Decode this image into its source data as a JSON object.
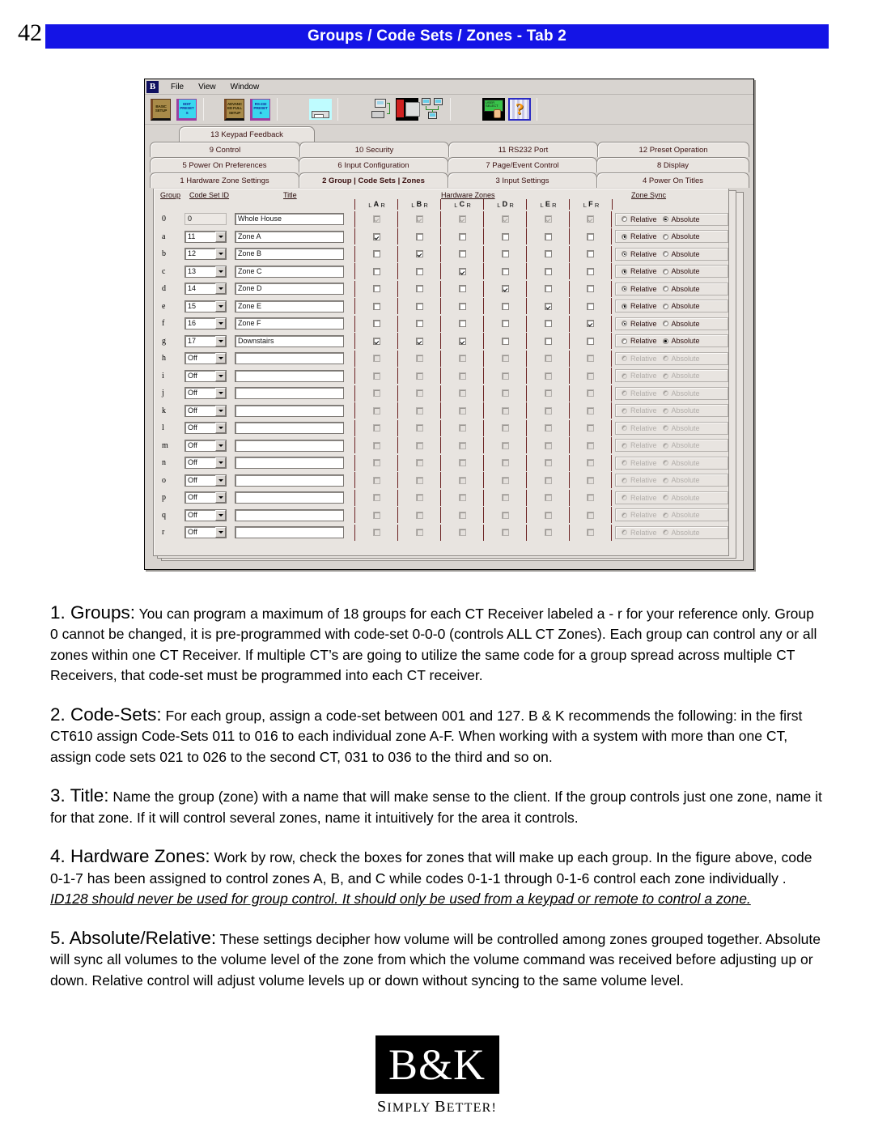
{
  "page": {
    "number": "42",
    "header_title": "Groups / Code Sets / Zones - Tab 2",
    "header_color": "#1414e6"
  },
  "app": {
    "menu": [
      "File",
      "View",
      "Window"
    ],
    "logo_icon": "bk-logo-icon",
    "toolbar_icons": [
      {
        "name": "basic-setup-icon",
        "label": "BASIC SETUP"
      },
      {
        "name": "edit-presets-icon",
        "label": "EDIT PRESETS"
      },
      {
        "name": "advanced-full-setup-icon",
        "label": "ADVANCED FULL SETUP"
      },
      {
        "name": "rs232-presets-icon",
        "label": "RS-232 PRESETS"
      },
      {
        "name": "device-front-panel-icon",
        "label": ""
      },
      {
        "name": "pc-to-device-icon",
        "label": ""
      },
      {
        "name": "rack-panel-icon",
        "label": ""
      },
      {
        "name": "network-icon",
        "label": ""
      },
      {
        "name": "user-select-icon",
        "label": ""
      },
      {
        "name": "help-icon",
        "label": "?"
      }
    ],
    "tab_rows": [
      [
        "13 Keypad Feedback"
      ],
      [
        "9   Control",
        "10   Security",
        "11   RS232 Port",
        "12   Preset Operation"
      ],
      [
        "5   Power On Preferences",
        "6   Input Configuration",
        "7   Page/Event Control",
        "8   Display"
      ],
      [
        "1   Hardware Zone Settings",
        "2  Group | Code Sets | Zones",
        "3   Input Settings",
        "4   Power On Titles"
      ]
    ],
    "active_tab": "2  Group | Code Sets | Zones",
    "column_headers": {
      "group": "Group",
      "code_set_id": "Code Set ID",
      "title": "Title",
      "hardware_zones": "Hardware Zones",
      "zone_sync": "Zone Sync"
    },
    "zone_letters": [
      "A",
      "B",
      "C",
      "D",
      "E",
      "F"
    ],
    "lr_labels": {
      "left": "L",
      "right": "R"
    },
    "sync_options": {
      "relative": "Relative",
      "absolute": "Absolute"
    },
    "dropdown_off_label": "Off",
    "rows": [
      {
        "group": "0",
        "code": "0",
        "title": "Whole House",
        "editable": false,
        "zones": [
          true,
          true,
          true,
          true,
          true,
          true
        ],
        "sync": "Absolute",
        "enabled": true
      },
      {
        "group": "a",
        "code": "11",
        "title": "Zone A",
        "editable": true,
        "zones": [
          true,
          false,
          false,
          false,
          false,
          false
        ],
        "sync": "Relative",
        "enabled": true
      },
      {
        "group": "b",
        "code": "12",
        "title": "Zone B",
        "editable": true,
        "zones": [
          false,
          true,
          false,
          false,
          false,
          false
        ],
        "sync": "Relative",
        "enabled": true
      },
      {
        "group": "c",
        "code": "13",
        "title": "Zone C",
        "editable": true,
        "zones": [
          false,
          false,
          true,
          false,
          false,
          false
        ],
        "sync": "Relative",
        "enabled": true
      },
      {
        "group": "d",
        "code": "14",
        "title": "Zone D",
        "editable": true,
        "zones": [
          false,
          false,
          false,
          true,
          false,
          false
        ],
        "sync": "Relative",
        "enabled": true
      },
      {
        "group": "e",
        "code": "15",
        "title": "Zone E",
        "editable": true,
        "zones": [
          false,
          false,
          false,
          false,
          true,
          false
        ],
        "sync": "Relative",
        "enabled": true
      },
      {
        "group": "f",
        "code": "16",
        "title": "Zone F",
        "editable": true,
        "zones": [
          false,
          false,
          false,
          false,
          false,
          true
        ],
        "sync": "Relative",
        "enabled": true
      },
      {
        "group": "g",
        "code": "17",
        "title": "Downstairs",
        "editable": true,
        "zones": [
          true,
          true,
          true,
          false,
          false,
          false
        ],
        "sync": "Absolute",
        "enabled": true
      },
      {
        "group": "h",
        "code": "Off",
        "title": "",
        "editable": true,
        "zones": [
          false,
          false,
          false,
          false,
          false,
          false
        ],
        "sync": "",
        "enabled": false
      },
      {
        "group": "i",
        "code": "Off",
        "title": "",
        "editable": true,
        "zones": [
          false,
          false,
          false,
          false,
          false,
          false
        ],
        "sync": "",
        "enabled": false
      },
      {
        "group": "j",
        "code": "Off",
        "title": "",
        "editable": true,
        "zones": [
          false,
          false,
          false,
          false,
          false,
          false
        ],
        "sync": "",
        "enabled": false
      },
      {
        "group": "k",
        "code": "Off",
        "title": "",
        "editable": true,
        "zones": [
          false,
          false,
          false,
          false,
          false,
          false
        ],
        "sync": "",
        "enabled": false
      },
      {
        "group": "l",
        "code": "Off",
        "title": "",
        "editable": true,
        "zones": [
          false,
          false,
          false,
          false,
          false,
          false
        ],
        "sync": "",
        "enabled": false
      },
      {
        "group": "m",
        "code": "Off",
        "title": "",
        "editable": true,
        "zones": [
          false,
          false,
          false,
          false,
          false,
          false
        ],
        "sync": "",
        "enabled": false
      },
      {
        "group": "n",
        "code": "Off",
        "title": "",
        "editable": true,
        "zones": [
          false,
          false,
          false,
          false,
          false,
          false
        ],
        "sync": "",
        "enabled": false
      },
      {
        "group": "o",
        "code": "Off",
        "title": "",
        "editable": true,
        "zones": [
          false,
          false,
          false,
          false,
          false,
          false
        ],
        "sync": "",
        "enabled": false
      },
      {
        "group": "p",
        "code": "Off",
        "title": "",
        "editable": true,
        "zones": [
          false,
          false,
          false,
          false,
          false,
          false
        ],
        "sync": "",
        "enabled": false
      },
      {
        "group": "q",
        "code": "Off",
        "title": "",
        "editable": true,
        "zones": [
          false,
          false,
          false,
          false,
          false,
          false
        ],
        "sync": "",
        "enabled": false
      },
      {
        "group": "r",
        "code": "Off",
        "title": "",
        "editable": true,
        "zones": [
          false,
          false,
          false,
          false,
          false,
          false
        ],
        "sync": "",
        "enabled": false
      }
    ]
  },
  "body": {
    "p1_lead": "1. Groups:",
    "p1_text": " You can program a maximum of 18 groups for each CT Receiver labeled a - r for your reference only. Group 0 cannot be changed, it is pre-programmed with code-set 0-0-0 (controls ALL CT Zones). Each group can control any or all zones within one CT Receiver. If multiple CT’s are going to utilize the same code for a group spread across multiple CT Receivers, that code-set must be programmed into each CT receiver.",
    "p2_lead": "2. Code-Sets:",
    "p2_text": " For each group, assign a code-set between 001 and 127. B & K  recommends the following: in the first CT610 assign Code-Sets 011 to 016 to each individual zone A-F. When working with a system with more than one CT, assign code sets 021 to 026 to the second CT, 031 to 036 to the third and so on.",
    "p3_lead": "3. Title:",
    "p3_text": " Name the group (zone) with a name that will make sense to the client. If the group controls just one zone, name it for that zone. If it will control several zones, name it intuitively for the area it controls.",
    "p4_lead": "4. Hardware Zones:",
    "p4_text": " Work by row, check the boxes for zones that will make up each group.  In the figure above, code 0-1-7 has been assigned to control zones A, B, and C while codes 0-1-1 through 0-1-6 control each zone individually . ",
    "p4_emphasis": "ID128 should never be used for group control. It should only be used from a keypad or remote to control a zone.",
    "p5_lead": "5. Absolute/Relative:",
    "p5_text": " These settings decipher how volume will be controlled among zones grouped together.  Absolute will sync all volumes to the volume level of the zone from which the volume command was received before adjusting up or down. Relative control will adjust volume levels up or down without syncing to the same volume level."
  },
  "logo": {
    "mark": "B&K",
    "tagline_first": "S",
    "tagline": "IMPLY",
    "tagline2_first": "B",
    "tagline2": "ETTER!",
    "full": "B&K"
  }
}
